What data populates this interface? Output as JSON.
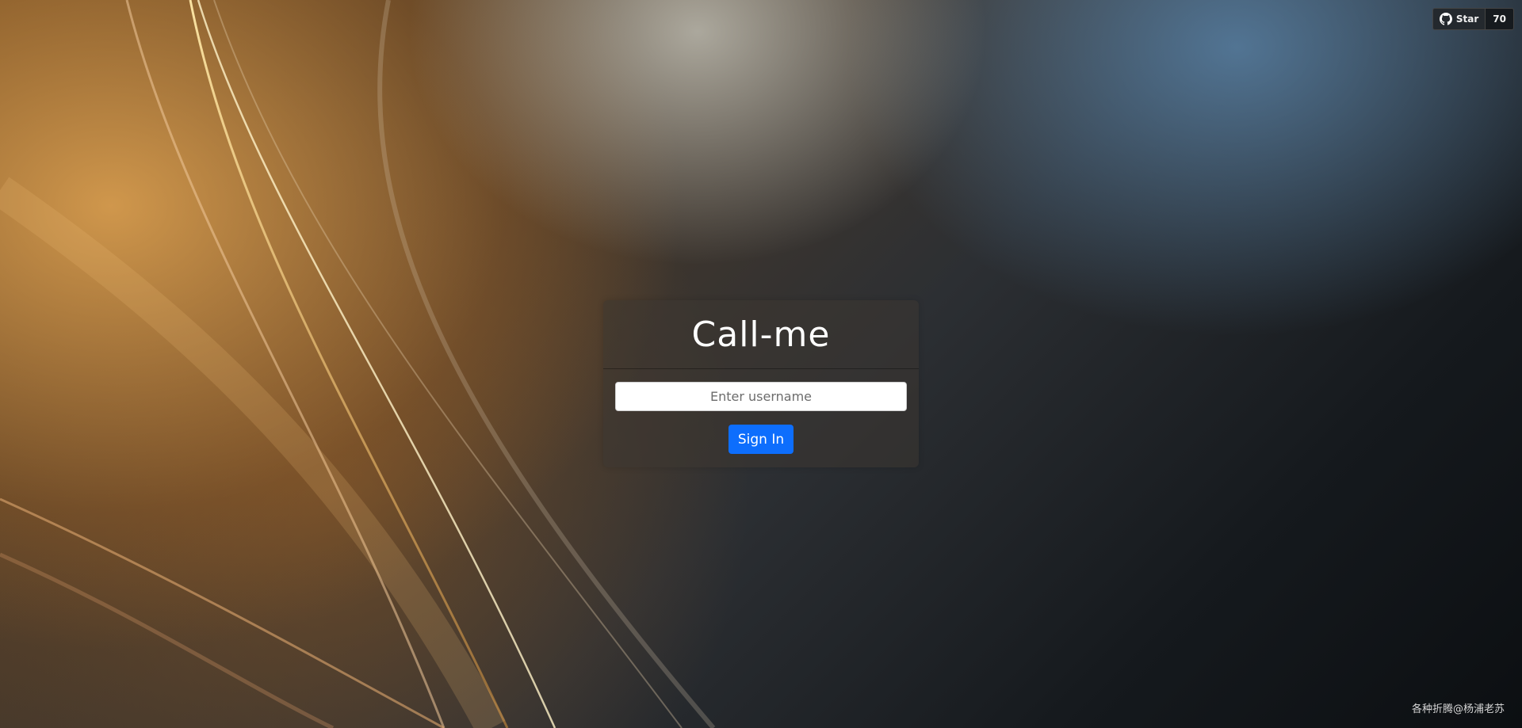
{
  "github_star": {
    "icon": "github-icon",
    "label": "Star",
    "count": "70"
  },
  "login": {
    "title": "Call-me",
    "username_placeholder": "Enter username",
    "username_value": "",
    "signin_label": "Sign In"
  },
  "footer": {
    "credit": "各种折腾@杨浦老苏"
  },
  "colors": {
    "primary_button": "#0d6efd",
    "title_text": "#ffffff"
  }
}
